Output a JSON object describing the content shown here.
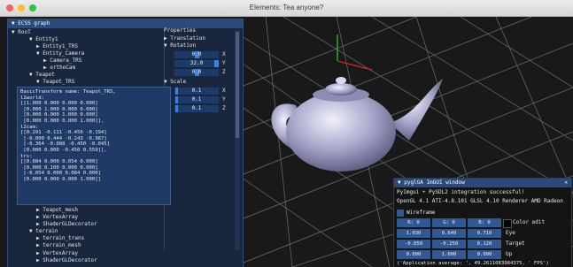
{
  "window": {
    "title": "Elements: Tea anyone?"
  },
  "graph": {
    "title": "ECSS graph",
    "root": "RooT",
    "items": [
      "Entity1",
      "Entity1_TRS",
      "Entity_Camera",
      "Camera_TRS",
      "orthoCam",
      "Teapot",
      "Teapot_TRS",
      "Teapot_mesh",
      "VertexArray",
      "ShaderGLDecorator",
      "terrain",
      "terrain_trans",
      "terrain_mesh",
      "VertexArray",
      "ShaderGLDecorator"
    ],
    "info": "BasicTransform name: Teapot_TRS,\nl2world:\n[[1.000 0.000 0.000 0.000]\n [0.000 1.000 0.000 0.000]\n [0.000 0.000 1.000 0.000]\n [0.000 0.000 0.000 1.000]],\nl2cam:\n[[0.291 -0.111 -0.450 -0.194]\n [-0.000 0.444 -0.243 -0.987]\n [-0.364 -0.088 -0.450 -0.045]\n [0.000 0.000 -0.450 0.559]],\ntrs:\n[[0.084 0.000 0.054 0.000]\n [0.000 0.100 0.000 0.000]\n [-0.054 0.000 0.084 0.000]\n [0.000 0.000 0.000 1.000]]"
  },
  "properties": {
    "title": "Properties",
    "translation_label": "Translation",
    "rotation_label": "Rotation",
    "rotation": {
      "x": "0.0",
      "y": "32.0",
      "z": "0.0"
    },
    "scale_label": "Scale",
    "scale": {
      "x": "0.1",
      "y": "0.1",
      "z": "0.1"
    },
    "axis_x": "X",
    "axis_y": "Y",
    "axis_z": "Z"
  },
  "imgui": {
    "title": "pyglGA ImGUI window",
    "line1": "PyImgui + PySDL2 integration successful!",
    "line2": "OpenGL 4.1 ATI-4.8.101 GLSL 4.10 Renderer AMD Radeon",
    "wireframe_label": "Wireframe",
    "color": {
      "r": "R:  0",
      "g": "G:  0",
      "b": "B:  0"
    },
    "color_edit_label": "Color edit",
    "eye": [
      "1.030",
      "0.640",
      "0.710"
    ],
    "eye_label": "Eye",
    "target": [
      "-0.050",
      "-0.250",
      "0.120"
    ],
    "target_label": "Target",
    "up": [
      "0.000",
      "1.000",
      "0.000"
    ],
    "up_label": "Up",
    "fps_text": "('Application average: ', 49.2611083984375, ' FPS')"
  },
  "colors": {
    "panel": "#18263e",
    "header": "#294a7a",
    "accent": "#3f7fe0"
  }
}
